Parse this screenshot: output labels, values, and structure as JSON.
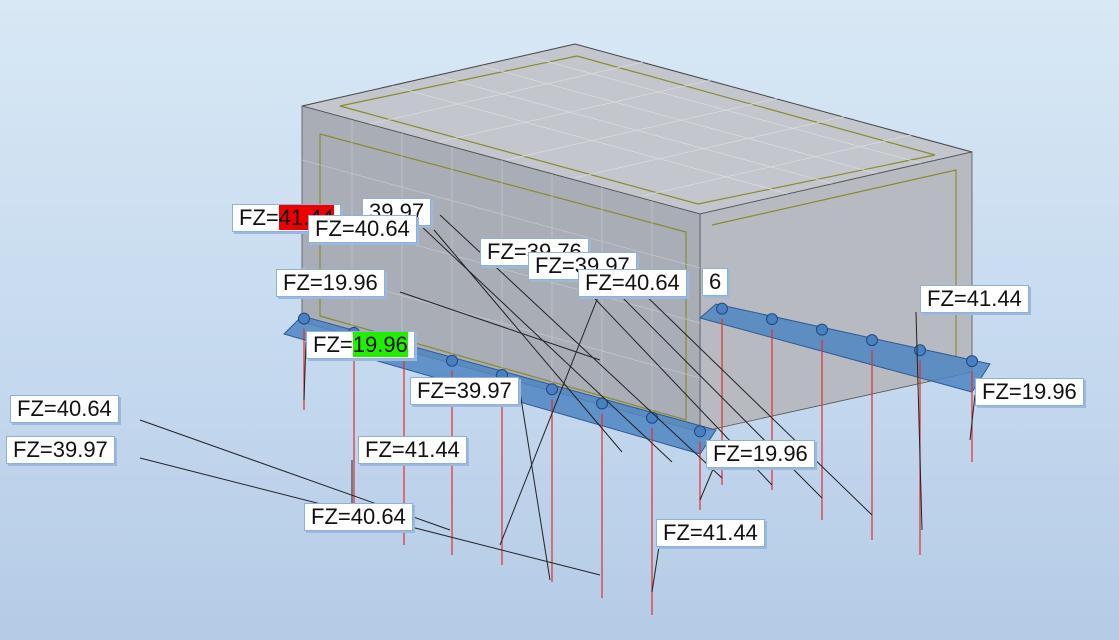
{
  "viewport_label": "Structural model view with support reactions",
  "reaction_prefix": "FZ=",
  "colors": {
    "background_top": "#d8e8f5",
    "background_bottom": "#b5cbe6",
    "wall_fill": "#a9adb6",
    "slab_fill": "#4f85c2",
    "pile_line": "#e03030",
    "leader_line": "#222222",
    "max_highlight": "#ee0000",
    "min_highlight": "#22ee00"
  },
  "reactions": [
    {
      "value": "41.44",
      "status": "max"
    },
    {
      "value": "39.97",
      "status": "normal"
    },
    {
      "value": "40.64",
      "status": "normal"
    },
    {
      "value": "39.76",
      "status": "normal"
    },
    {
      "value": "39.97",
      "status": "normal"
    },
    {
      "value": "40.64",
      "status": "normal"
    },
    {
      "value": "6",
      "status": "normal",
      "truncated": true
    },
    {
      "value": "19.96",
      "status": "normal"
    },
    {
      "value": "41.44",
      "status": "normal"
    },
    {
      "value": "19.96",
      "status": "min"
    },
    {
      "value": "39.97",
      "status": "normal"
    },
    {
      "value": "19.96",
      "status": "normal"
    },
    {
      "value": "40.64",
      "status": "normal"
    },
    {
      "value": "39.97",
      "status": "normal"
    },
    {
      "value": "41.44",
      "status": "normal"
    },
    {
      "value": "19.96",
      "status": "normal"
    },
    {
      "value": "40.64",
      "status": "normal"
    },
    {
      "value": "41.44",
      "status": "normal"
    }
  ]
}
